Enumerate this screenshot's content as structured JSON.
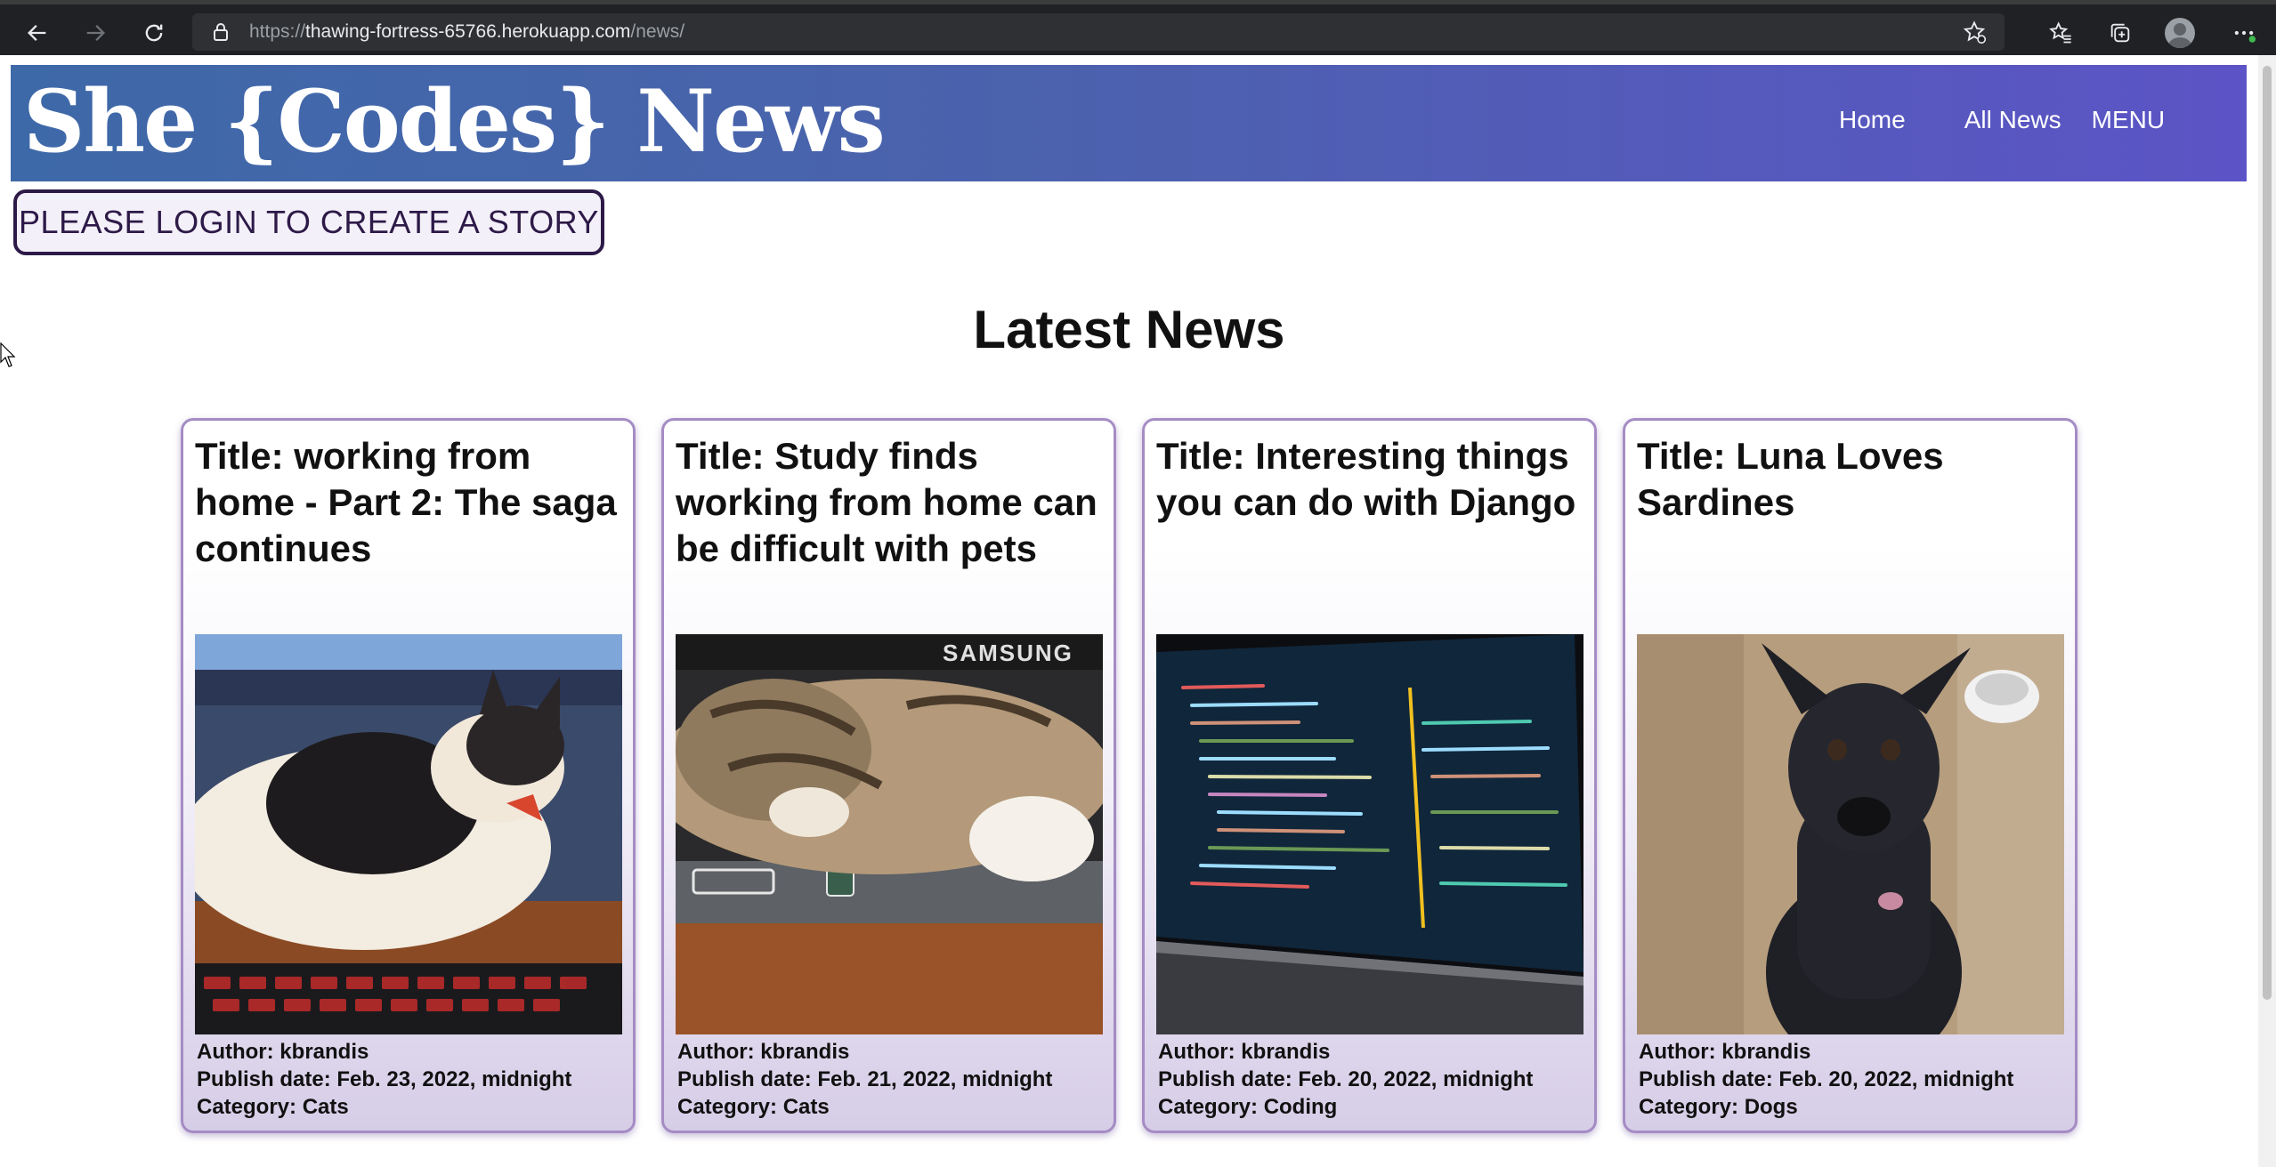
{
  "browser": {
    "url_prefix": "https://",
    "url_host": "thawing-fortress-65766.herokuapp.com",
    "url_path": "/news/",
    "icons": [
      "back-arrow-icon",
      "forward-arrow-icon",
      "refresh-icon",
      "lock-icon",
      "star-add-icon",
      "favorites-icon",
      "collections-icon",
      "profile-icon",
      "more-icon"
    ]
  },
  "header": {
    "logo": "She {Codes} News",
    "nav": {
      "home": "Home",
      "all_news": "All News",
      "menu": "MENU"
    }
  },
  "login_prompt": "PLEASE LOGIN TO CREATE A STORY",
  "page_heading": "Latest News",
  "stories": [
    {
      "title": "Title: working from home - Part 2: The saga continues",
      "author": "Author: kbrandis",
      "publish_date": "Publish date: Feb. 23, 2022, midnight",
      "category": "Category: Cats",
      "image": "cat-on-keyboard"
    },
    {
      "title": "Title: Study finds working from home can be difficult with pets",
      "author": "Author: kbrandis",
      "publish_date": "Publish date: Feb. 21, 2022, midnight",
      "category": "Category: Cats",
      "image": "cat-on-laptop",
      "image_text": "SAMSUNG"
    },
    {
      "title": "Title: Interesting things you can do with Django",
      "author": "Author: kbrandis",
      "publish_date": "Publish date: Feb. 20, 2022, midnight",
      "category": "Category: Coding",
      "image": "code-on-laptop"
    },
    {
      "title": "Title: Luna Loves Sardines",
      "author": "Author: kbrandis",
      "publish_date": "Publish date: Feb. 20, 2022, midnight",
      "category": "Category: Dogs",
      "image": "black-dog"
    }
  ],
  "colors": {
    "header_gradient_start": "#3e69a8",
    "header_gradient_end": "#5c54c6",
    "card_border": "#a58cc4",
    "login_border": "#2d1a48"
  }
}
